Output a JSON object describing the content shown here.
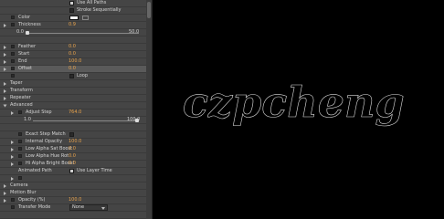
{
  "effects": {
    "use_all_paths": "Use All Paths",
    "stroke_sequentially": "Stroke Sequentially",
    "color": "Color",
    "thickness": {
      "label": "Thickness",
      "value": "0.9",
      "min": "0.0",
      "max": "50.0"
    },
    "feather": {
      "label": "Feather",
      "value": "0.0"
    },
    "start": {
      "label": "Start",
      "value": "0.0"
    },
    "end": {
      "label": "End",
      "value": "100.0"
    },
    "offset": {
      "label": "Offset",
      "value": "0.0"
    },
    "loop": "Loop",
    "taper": "Taper",
    "transform": "Transform",
    "repeater": "Repeater",
    "advanced": "Advanced",
    "adjust_step": {
      "label": "Adjust Step",
      "value": "764.0",
      "min": "1.0",
      "max": "100.0"
    },
    "exact_step_match": "Exact Step Match",
    "internal_opacity": {
      "label": "Internal Opacity",
      "value": "100.0"
    },
    "low_alpha_sat_boost": {
      "label": "Low Alpha Sat Boost",
      "value": "0.0"
    },
    "low_alpha_hue_rot": {
      "label": "Low Alpha Hue Rot",
      "value": "0.0"
    },
    "hi_alpha_bright_boost": {
      "label": "Hi Alpha Bright Boost",
      "value": "0.0"
    },
    "animated_path": "Animated Path",
    "use_layer_time": "Use Layer Time",
    "camera": "Camera",
    "motion_blur": "Motion Blur",
    "opacity": {
      "label": "Opacity (%)",
      "value": "100.0"
    },
    "transfer_mode": {
      "label": "Transfer Mode",
      "value": "None"
    }
  },
  "preview": {
    "text": "czpcheng"
  },
  "colors": {
    "value": "#e8a24a",
    "panel": "#454545",
    "background": "#000000"
  },
  "slider_levels": {
    "thickness": 0.018,
    "adjust_step": 1.0
  }
}
